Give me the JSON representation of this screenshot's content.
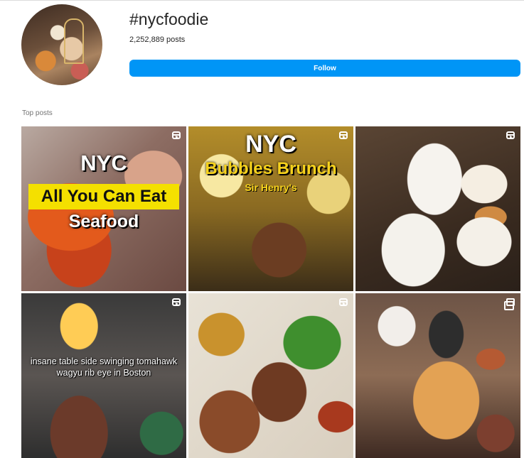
{
  "header": {
    "hashtag": "#nycfoodie",
    "post_count": "2,252,889 posts",
    "follow_label": "Follow"
  },
  "section": {
    "label": "Top posts"
  },
  "posts": [
    {
      "type": "reel",
      "lines": [
        "NYC",
        "All You Can Eat",
        "Seafood"
      ]
    },
    {
      "type": "reel",
      "lines": [
        "NYC",
        "Bubbles Brunch",
        "Sir Henry's"
      ]
    },
    {
      "type": "reel",
      "lines": []
    },
    {
      "type": "reel",
      "lines": [
        "insane table side swinging tomahawk wagyu rib eye in Boston"
      ]
    },
    {
      "type": "reel",
      "lines": []
    },
    {
      "type": "carousel",
      "lines": []
    }
  ],
  "colors": {
    "follow": "#0095f6",
    "highlight": "#f4e000"
  },
  "icons": {
    "reel": "reel-icon",
    "carousel": "carousel-icon"
  }
}
